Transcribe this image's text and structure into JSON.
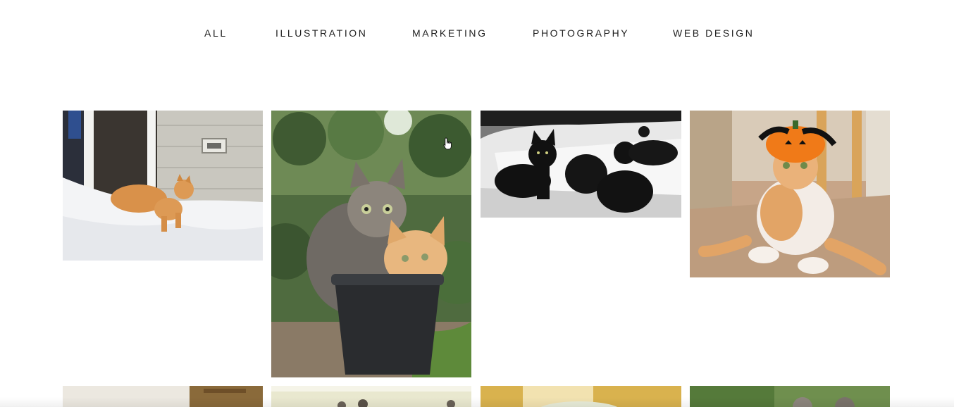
{
  "filters": [
    {
      "label": "ALL"
    },
    {
      "label": "ILLUSTRATION"
    },
    {
      "label": "MARKETING"
    },
    {
      "label": "PHOTOGRAPHY"
    },
    {
      "label": "WEB DESIGN"
    }
  ],
  "gallery": {
    "items": [
      {
        "icon": "orange-cat-in-snow-photo"
      },
      {
        "icon": "kittens-in-flowerpot-photo"
      },
      {
        "icon": "black-cats-on-sofa-photo"
      },
      {
        "icon": "cat-in-pumpkin-hat-photo"
      },
      {
        "icon": "cat-photo"
      },
      {
        "icon": "cats-photo"
      },
      {
        "icon": "cat-photo"
      },
      {
        "icon": "kittens-photo"
      }
    ]
  },
  "cursor": {
    "icon": "hand-pointer-icon"
  },
  "colors": {
    "background": "#ffffff",
    "text": "#1f1f1f"
  }
}
